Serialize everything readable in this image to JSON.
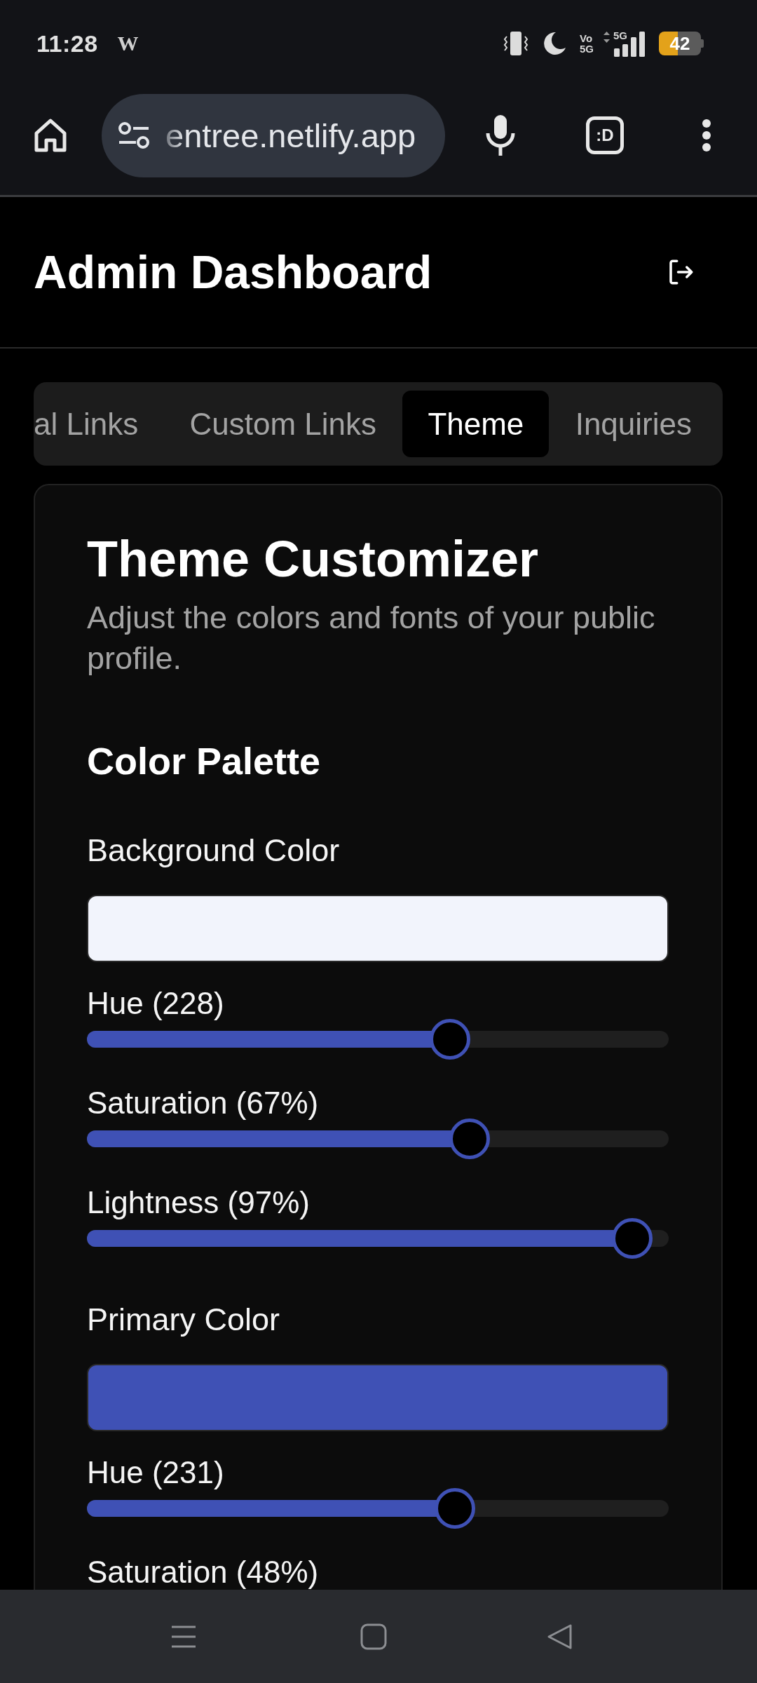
{
  "status_bar": {
    "time": "11:28",
    "notification": "W",
    "volte": [
      "Vo",
      "5G"
    ],
    "network": "5G",
    "battery": "42"
  },
  "browser_bar": {
    "url": "entree.netlify.app",
    "tab_switcher": ":D"
  },
  "header": {
    "title": "Admin Dashboard"
  },
  "tabs": [
    {
      "label": "al Links",
      "selected": false
    },
    {
      "label": "Custom Links",
      "selected": false
    },
    {
      "label": "Theme",
      "selected": true
    },
    {
      "label": "Inquiries",
      "selected": false
    }
  ],
  "card": {
    "title": "Theme Customizer",
    "subtitle": "Adjust the colors and fonts of your public profile.",
    "section_title": "Color Palette",
    "colors": [
      {
        "label": "Background Color",
        "color": "#f2f4fc",
        "sliders": [
          {
            "label": "Hue (228)",
            "level": 0.633
          },
          {
            "label": "Saturation (67%)",
            "level": 0.67
          },
          {
            "label": "Lightness (97%)",
            "level": 0.97
          }
        ]
      },
      {
        "label": "Primary Color",
        "color": "#3f51b5",
        "sliders": [
          {
            "label": "Hue (231)",
            "level": 0.642
          },
          {
            "label": "Saturation (48%)"
          }
        ]
      }
    ]
  }
}
